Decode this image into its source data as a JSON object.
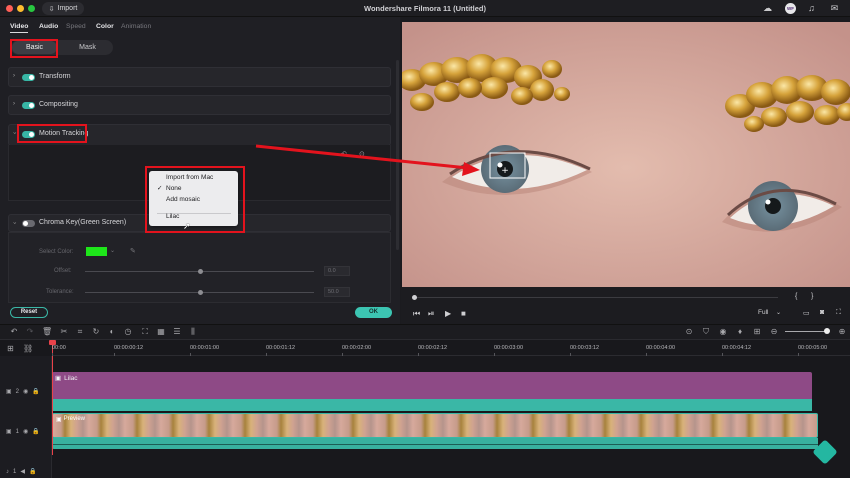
{
  "titlebar": {
    "import_label": "Import",
    "app_title": "Wondershare Filmora 11 (Untitled)",
    "avatar_initials": "WF"
  },
  "left_panel": {
    "tabs": [
      {
        "label": "Video",
        "active": true
      },
      {
        "label": "Audio",
        "active": false
      },
      {
        "label": "Speed",
        "active": false
      },
      {
        "label": "Color",
        "active": false
      },
      {
        "label": "Animation",
        "active": false
      }
    ],
    "subtabs": {
      "basic": "Basic",
      "mask": "Mask"
    },
    "sections": {
      "transform": "Transform",
      "compositing": "Compositing",
      "motion_tracking": "Motion Tracking",
      "chroma_key": "Chroma Key(Green Screen)"
    },
    "chroma": {
      "select_color_label": "Select Color:",
      "select_color_value": "#1ee61a",
      "offset_label": "Offset:",
      "offset_value": "0.0",
      "offset_level": 0.5,
      "tolerance_label": "Tolerance:",
      "tolerance_value": "50.0",
      "tolerance_level": 0.5
    },
    "reset_label": "Reset",
    "ok_label": "OK"
  },
  "tracking_menu": {
    "items": [
      {
        "label": "Import from Mac",
        "checked": false
      },
      {
        "label": "None",
        "checked": true
      },
      {
        "label": "Add mosaic",
        "checked": false
      },
      {
        "label": "Lilac",
        "checked": false
      }
    ]
  },
  "preview": {
    "quality": "Full",
    "playback_progress": 0.0
  },
  "timeline": {
    "ruler_labels": [
      "00:00",
      "00:00:00:12",
      "00:00:01:00",
      "00:00:01:12",
      "00:00:02:00",
      "00:00:02:12",
      "00:00:03:00",
      "00:00:03:12",
      "00:00:04:00",
      "00:00:04:12",
      "00:00:05:00"
    ],
    "tracks": [
      {
        "index": "2",
        "clip_label": "Lilac"
      },
      {
        "index": "1",
        "clip_label": "Preview"
      },
      {
        "index": "1"
      }
    ]
  },
  "colors": {
    "accent": "#3cc5b2",
    "highlight": "#e3131d",
    "lilac_clip": "#8e4a86"
  }
}
